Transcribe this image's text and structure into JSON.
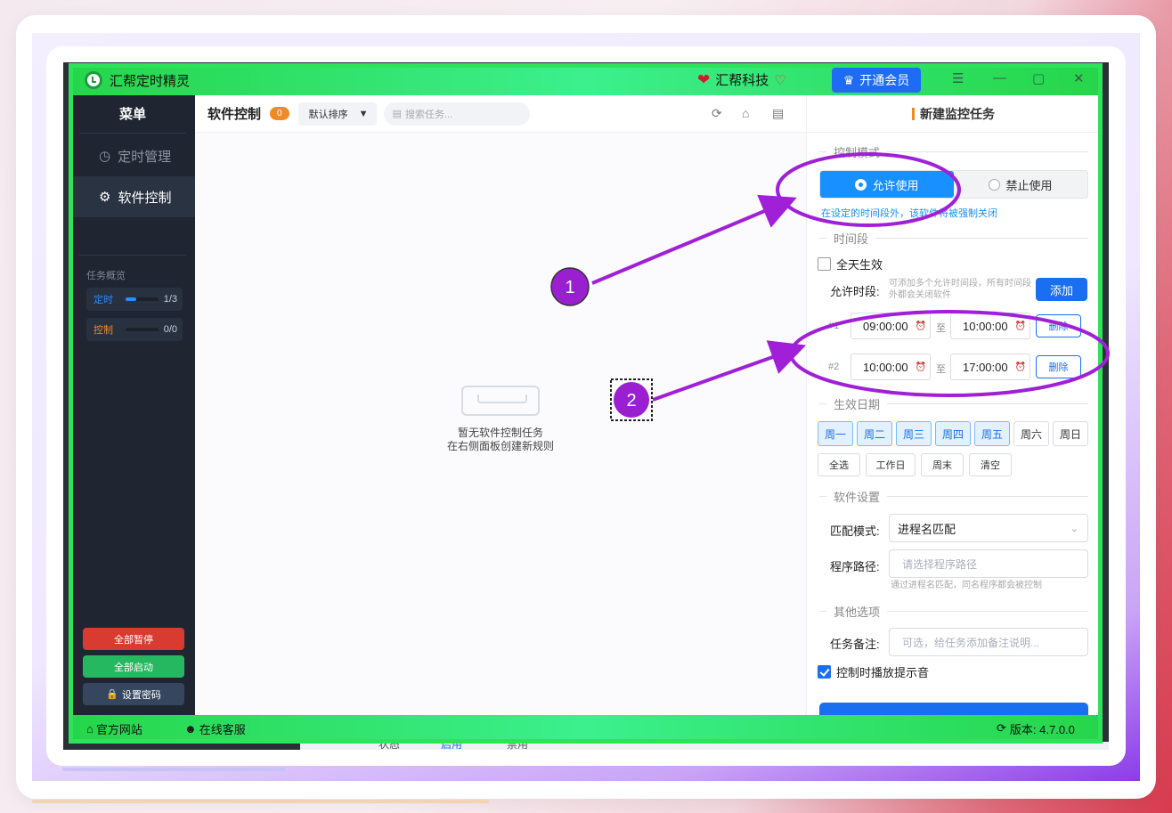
{
  "app": {
    "title": "汇帮定时精灵",
    "brand": "汇帮科技",
    "vip_label": "开通会员"
  },
  "sidebar": {
    "menu_title": "菜单",
    "items": [
      {
        "label": "定时管理",
        "icon": "alarm-clock-icon",
        "active": false
      },
      {
        "label": "软件控制",
        "icon": "gear-icon",
        "active": true
      }
    ],
    "overview_title": "任务概览",
    "overview": [
      {
        "name": "定时",
        "count": "1/3",
        "progress": 0.33,
        "color": "#2b8cff"
      },
      {
        "name": "控制",
        "count": "0/0",
        "progress": 0,
        "color": "#f08a24"
      }
    ],
    "pause_all": "全部暂停",
    "start_all": "全部启动",
    "set_password": "设置密码"
  },
  "toolbar": {
    "title": "软件控制",
    "count": "0",
    "sort": "默认排序",
    "search_placeholder": "搜索任务..."
  },
  "empty": {
    "line1": "暂无软件控制任务",
    "line2": "在右侧面板创建新规则"
  },
  "panel": {
    "title": "新建监控任务",
    "control_mode_section": "控制模式",
    "mode_allow": "允许使用",
    "mode_deny": "禁止使用",
    "mode_selected": "允许使用",
    "mode_hint": "在设定的时间段外，该软件将被强制关闭",
    "time_section": "时间段",
    "all_day": "全天生效",
    "all_day_checked": false,
    "allowed_label": "允许时段:",
    "allowed_hint": "可添加多个允许时间段，所有时间段外都会关闭软件",
    "add_button": "添加",
    "slots": [
      {
        "index": "#1",
        "start": "09:00:00",
        "end": "10:00:00"
      },
      {
        "index": "#2",
        "start": "10:00:00",
        "end": "17:00:00"
      }
    ],
    "to_label": "至",
    "delete_label": "删除",
    "date_section": "生效日期",
    "days": [
      {
        "label": "周一",
        "on": true
      },
      {
        "label": "周二",
        "on": true
      },
      {
        "label": "周三",
        "on": true
      },
      {
        "label": "周四",
        "on": true
      },
      {
        "label": "周五",
        "on": true
      },
      {
        "label": "周六",
        "on": false
      },
      {
        "label": "周日",
        "on": false
      }
    ],
    "quick": [
      "全选",
      "工作日",
      "周末",
      "清空"
    ],
    "software_section": "软件设置",
    "match_label": "匹配模式:",
    "match_value": "进程名匹配",
    "path_label": "程序路径:",
    "path_placeholder": "请选择程序路径",
    "path_hint": "通过进程名匹配，同名程序都会被控制",
    "other_section": "其他选项",
    "note_label": "任务备注:",
    "note_placeholder": "可选，给任务添加备注说明...",
    "sound_label": "控制时播放提示音",
    "sound_checked": true
  },
  "statusbar": {
    "website": "官方网站",
    "support": "在线客服",
    "version": "版本:  4.7.0.0"
  },
  "behind": {
    "status": "状态",
    "enable": "启用",
    "disable": "禁用"
  },
  "annotations": [
    {
      "label": "1"
    },
    {
      "label": "2"
    }
  ],
  "colors": {
    "highlight_green": "#2ee35a",
    "annotation_purple": "#a020d8",
    "accent_blue": "#1a6ff0",
    "accent_orange": "#f08a24"
  }
}
